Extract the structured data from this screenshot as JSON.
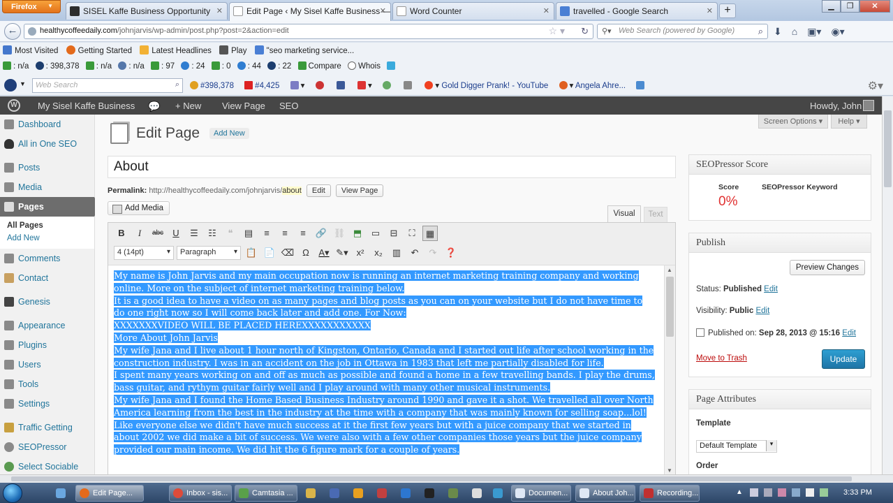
{
  "browser": {
    "menu_label": "Firefox",
    "tabs": [
      {
        "label": "SISEL Kaffe Business Opportunity",
        "color": "#2d2d2d"
      },
      {
        "label": "Edit Page ‹ My Sisel Kaffe Business — ...",
        "color": "#3a3a3a"
      },
      {
        "label": "Word Counter",
        "color": "#bbbbbb"
      },
      {
        "label": "travelled - Google Search",
        "color": "#4a7fd4"
      }
    ],
    "url_host": "healthycoffeedaily.com",
    "url_path": "/johnjarvis/wp-admin/post.php?post=2&action=edit",
    "search_placeholder": "Web Search (powered by Google)",
    "bookmarks": [
      "Most Visited",
      "Getting Started",
      "Latest Headlines",
      "Play",
      "\"seo marketing service..."
    ],
    "seo_stats": [
      ": n/a",
      ": 398,378",
      ": n/a",
      ": n/a",
      ": 97",
      ": 24",
      ": 0",
      ": 44",
      ": 22",
      "Compare",
      "Whois"
    ],
    "toolbar3_search_placeholder": "Web Search",
    "toolbar3_items": [
      "#398,378",
      "#4,425",
      "Gold Digger Prank! - YouTube",
      "Angela Ahre..."
    ]
  },
  "adminbar": {
    "site_name": "My Sisel Kaffe Business",
    "new_label": "+ New",
    "view_label": "View Page",
    "seo_label": "SEO",
    "howdy": "Howdy, John"
  },
  "sidebar": {
    "items": [
      {
        "label": "Dashboard"
      },
      {
        "label": "All in One SEO"
      },
      {
        "label": "Posts"
      },
      {
        "label": "Media"
      },
      {
        "label": "Pages"
      },
      {
        "label": "Comments"
      },
      {
        "label": "Contact"
      },
      {
        "label": "Genesis"
      },
      {
        "label": "Appearance"
      },
      {
        "label": "Plugins"
      },
      {
        "label": "Users"
      },
      {
        "label": "Tools"
      },
      {
        "label": "Settings"
      },
      {
        "label": "Traffic Getting"
      },
      {
        "label": "SEOPressor"
      },
      {
        "label": "Select Sociable"
      }
    ],
    "submenu": [
      "All Pages",
      "Add New"
    ]
  },
  "main": {
    "screen_options": "Screen Options ▾",
    "help": "Help ▾",
    "page_title": "Edit Page",
    "add_new": "Add New",
    "post_title": "About",
    "permalink_label": "Permalink:",
    "permalink_url": "http://healthycoffeedaily.com/johnjarvis/",
    "permalink_slug": "about",
    "edit_label": "Edit",
    "view_page_label": "View Page",
    "add_media": "Add Media",
    "tab_visual": "Visual",
    "tab_text": "Text",
    "font_size": "4 (14pt)",
    "format": "Paragraph",
    "content": [
      "My name is John Jarvis and my main occupation now is running an internet marketing training company and working online. More on the subject of internet marketing training below.",
      "It is a good idea to have a video on as many pages and blog posts as you can on your website but I do not have time to do one right now so I will come back later and add one. For Now:",
      "XXXXXXXVIDEO WILL BE PLACED HEREXXXXXXXXXXX",
      "More About John Jarvis",
      "My wife Jana and I live about 1 hour north of Kingston, Ontario, Canada and I started out life after school working in the construction industry. I was in an accident on the job in Ottawa in 1983 that left me partially disabled for life.",
      "I spent many years working on and off as much as possible and found a home in a few travelling bands. I play the drums, bass guitar, and rythym guitar fairly well and I play around with many other musical instruments.",
      "My wife Jana and I found the Home Based Business Industry around 1990 and gave it a shot. We travelled all over North America learning from the best in the industry at the time with a company that was mainly known for selling soap...lol!",
      "Like everyone else we didn't have much success at it the first few years but with a juice company that we started in about 2002 we did make a bit of success. We were also with a few other companies those years but the juice company provided our main income. We did hit the 6 figure mark for a couple of years."
    ],
    "selection_color": "#3399ff"
  },
  "seopressor": {
    "title": "SEOPressor Score",
    "score_label": "Score",
    "keyword_label": "SEOPressor Keyword",
    "score_value": "0%"
  },
  "publish": {
    "title": "Publish",
    "preview": "Preview Changes",
    "status_label": "Status:",
    "status_value": "Published",
    "visibility_label": "Visibility:",
    "visibility_value": "Public",
    "published_label": "Published on:",
    "published_value": "Sep 28, 2013 @ 15:16",
    "edit": "Edit",
    "trash": "Move to Trash",
    "update": "Update"
  },
  "attributes": {
    "title": "Page Attributes",
    "template_label": "Template",
    "template_value": "Default Template",
    "order_label": "Order"
  },
  "taskbar": {
    "tasks": [
      "Edit Page...",
      "Inbox - sis...",
      "Camtasia ...",
      "Documen...",
      "About Joh...",
      "Recording..."
    ],
    "clock": "3:33 PM"
  }
}
